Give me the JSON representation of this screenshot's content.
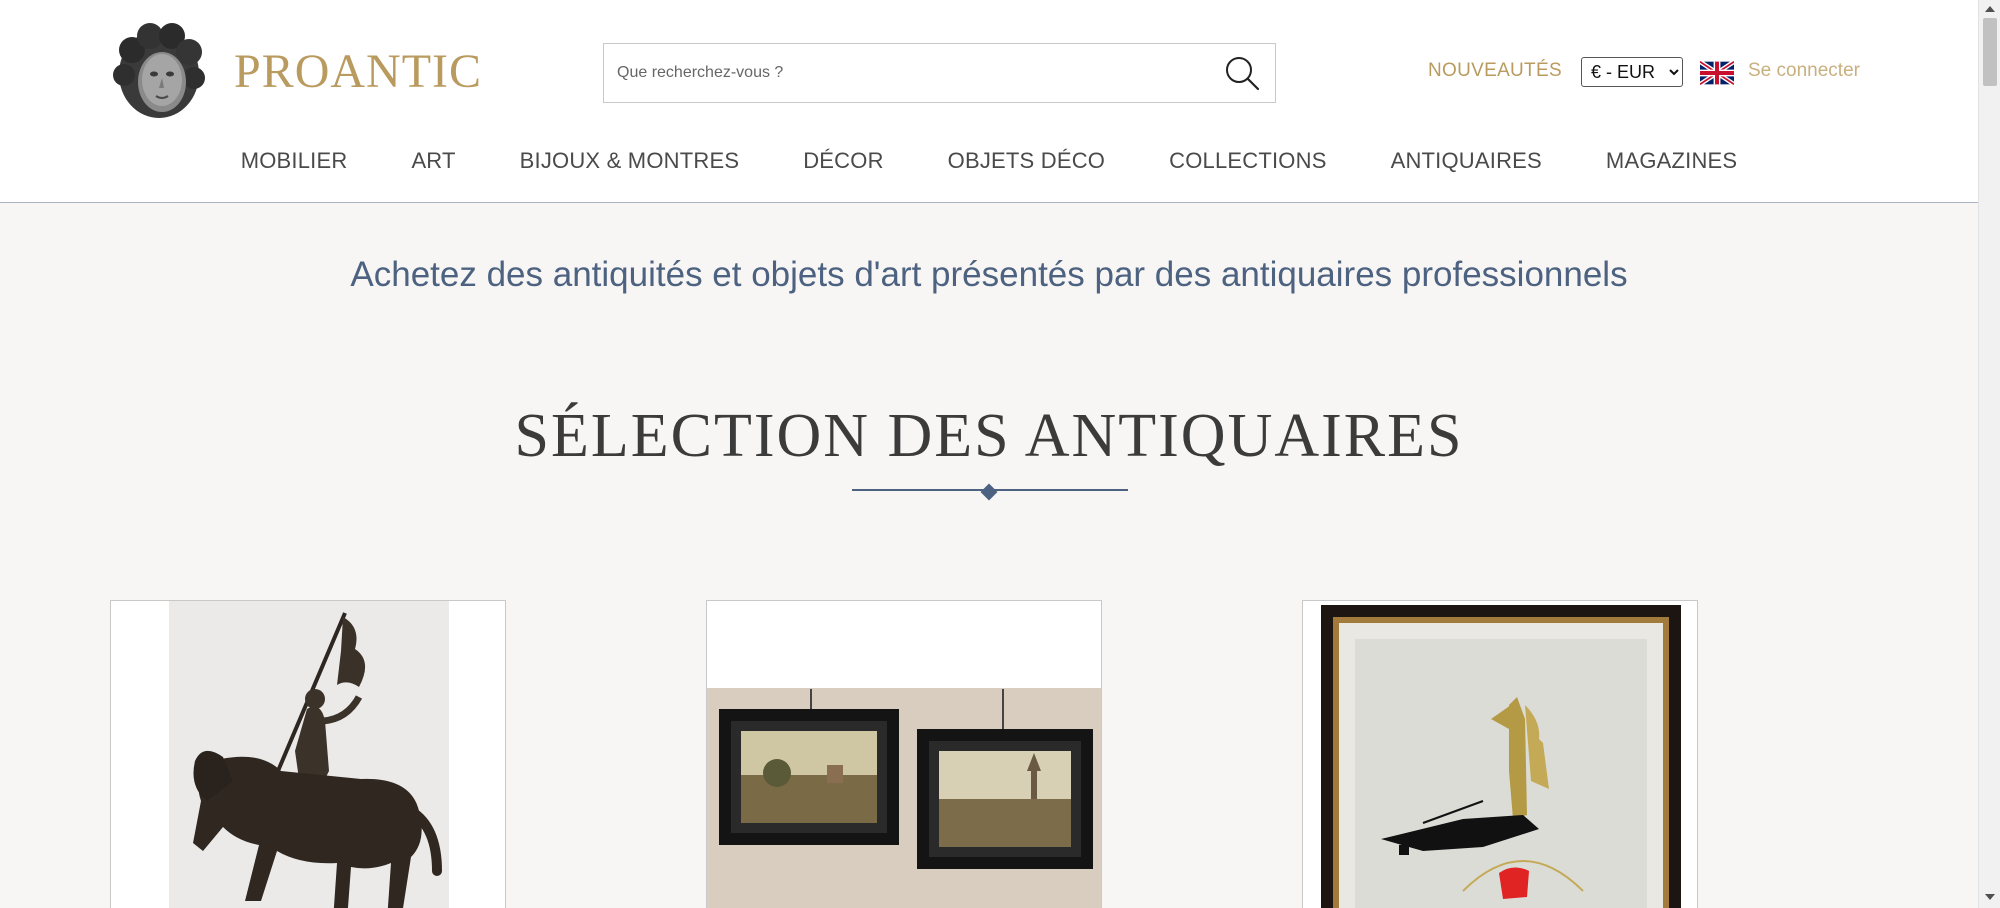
{
  "brand": {
    "name": "PROANTIC"
  },
  "search": {
    "placeholder": "Que recherchez-vous ?"
  },
  "header": {
    "new_label": "NOUVEAUTÉS",
    "currency": {
      "selected": "€ - EUR",
      "options": [
        "€ - EUR"
      ]
    },
    "language_flag": "uk-flag-icon",
    "login_label": "Se connecter"
  },
  "nav": {
    "items": [
      {
        "label": "MOBILIER"
      },
      {
        "label": "ART"
      },
      {
        "label": "BIJOUX & MONTRES"
      },
      {
        "label": "DÉCOR"
      },
      {
        "label": "OBJETS DÉCO"
      },
      {
        "label": "COLLECTIONS"
      },
      {
        "label": "ANTIQUAIRES"
      },
      {
        "label": "MAGAZINES"
      }
    ]
  },
  "main": {
    "tagline": "Achetez des antiquités et objets d'art présentés par des antiquaires professionnels",
    "section_title": "SÉLECTION DES ANTIQUAIRES",
    "cards": [
      {
        "image": "bronze-equestrian-statue"
      },
      {
        "image": "pair-of-framed-landscape-paintings"
      },
      {
        "image": "framed-abstract-artwork"
      }
    ]
  },
  "colors": {
    "brand_gold": "#b99b5f",
    "accent_blue": "#4c6280",
    "background": "#f7f6f4"
  }
}
